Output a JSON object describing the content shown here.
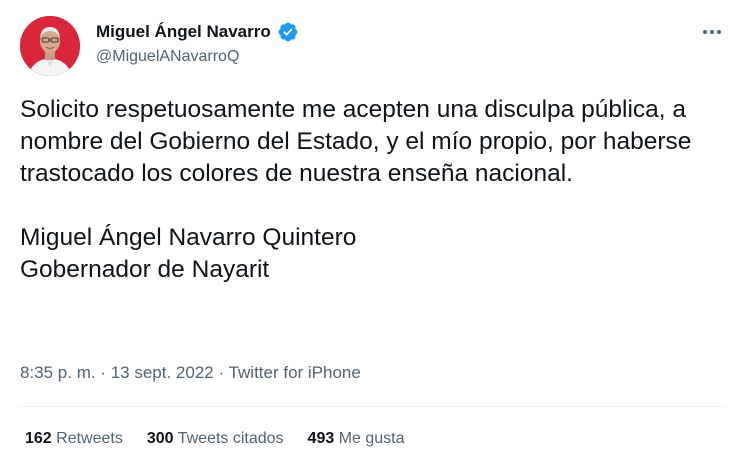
{
  "author": {
    "display_name": "Miguel Ángel Navarro",
    "handle": "@MiguelANavarroQ",
    "verified": true,
    "avatar_bg": "#d9263a"
  },
  "tweet": {
    "paragraph_1": "Solicito respetuosamente me acepten una disculpa pública, a nombre del Gobierno del Estado, y el mío propio, por haberse trastocado los colores de nuestra enseña nacional.",
    "signature_line_1": "Miguel Ángel Navarro Quintero",
    "signature_line_2": "Gobernador de Nayarit"
  },
  "meta": {
    "time": "8:35 p. m.",
    "separator": " · ",
    "date": "13 sept. 2022",
    "source": "Twitter for iPhone"
  },
  "stats": {
    "retweets_count": "162",
    "retweets_label": "Retweets",
    "quotes_count": "300",
    "quotes_label": "Tweets citados",
    "likes_count": "493",
    "likes_label": "Me gusta"
  },
  "icons": {
    "verified": "verified-badge-icon",
    "more": "more-options-icon"
  },
  "colors": {
    "text": "#0f1419",
    "secondary": "#536471",
    "verified": "#1d9bf0",
    "divider": "#eff3f4"
  }
}
